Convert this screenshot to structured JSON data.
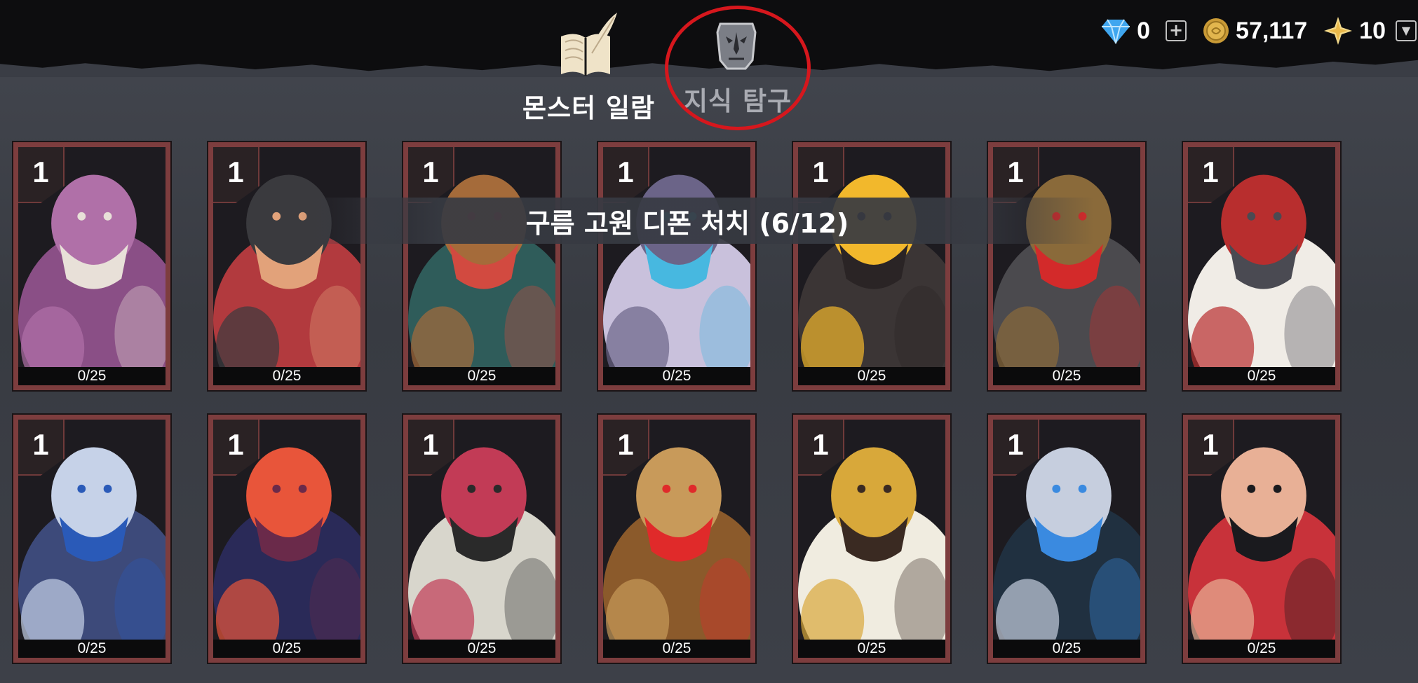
{
  "tabs": [
    {
      "label": "몬스터 일람",
      "icon": "book-icon",
      "active": true
    },
    {
      "label": "지식 탐구",
      "icon": "mask-icon",
      "active": false
    }
  ],
  "currency": {
    "gems": "0",
    "gold": "57,117",
    "stars": "10"
  },
  "quest": {
    "text": "구름 고원 디폰 처치 (6/12)"
  },
  "cards": [
    {
      "level": "1",
      "progress": "0/25",
      "art": "purple-maw-monster",
      "colors": [
        "#8a4f86",
        "#b070a8",
        "#e8e0d8"
      ]
    },
    {
      "level": "1",
      "progress": "0/25",
      "art": "red-horned-demon",
      "colors": [
        "#b23a3e",
        "#3a3a3e",
        "#e2a27a"
      ]
    },
    {
      "level": "1",
      "progress": "0/25",
      "art": "teal-lizard-beast",
      "colors": [
        "#2f5c5a",
        "#a56b3a",
        "#d24a40"
      ]
    },
    {
      "level": "1",
      "progress": "0/25",
      "art": "white-griffin",
      "colors": [
        "#c9c1dc",
        "#6b6488",
        "#47b8e0"
      ]
    },
    {
      "level": "1",
      "progress": "0/25",
      "art": "rune-golem",
      "colors": [
        "#3b3535",
        "#f2b82c",
        "#2a2425"
      ]
    },
    {
      "level": "1",
      "progress": "0/25",
      "art": "goblin-brute",
      "colors": [
        "#4b4a4e",
        "#8a6a3a",
        "#d32a2a"
      ]
    },
    {
      "level": "1",
      "progress": "0/25",
      "art": "bearded-noble",
      "colors": [
        "#f0ece6",
        "#b82e2e",
        "#4a4a52"
      ]
    },
    {
      "level": "1",
      "progress": "0/25",
      "art": "blue-orc-warrior",
      "colors": [
        "#3d4a7a",
        "#c6d2e8",
        "#2a5ab8"
      ]
    },
    {
      "level": "1",
      "progress": "0/25",
      "art": "fire-crow",
      "colors": [
        "#2a2a58",
        "#e8553a",
        "#6a2a4a"
      ]
    },
    {
      "level": "1",
      "progress": "0/25",
      "art": "bone-plant-dragon",
      "colors": [
        "#d8d6cc",
        "#c23b56",
        "#2a2a2a"
      ]
    },
    {
      "level": "1",
      "progress": "0/25",
      "art": "brass-robot",
      "colors": [
        "#8b5a2b",
        "#c89a5a",
        "#e02a2a"
      ]
    },
    {
      "level": "1",
      "progress": "0/25",
      "art": "winged-valkyrie",
      "colors": [
        "#f0ece0",
        "#d8a83a",
        "#3a2a22"
      ]
    },
    {
      "level": "1",
      "progress": "0/25",
      "art": "hooded-wraith",
      "colors": [
        "#203040",
        "#c6cede",
        "#3a8ae0"
      ]
    },
    {
      "level": "1",
      "progress": "0/25",
      "art": "red-haired-woman",
      "colors": [
        "#c8323a",
        "#e8b096",
        "#1a1a1e"
      ]
    }
  ]
}
